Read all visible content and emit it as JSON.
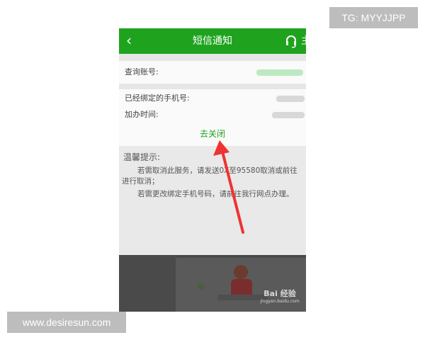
{
  "topbar": {
    "back_icon": "chevron-left-icon",
    "title": "短信通知",
    "headset_icon": "headset-icon",
    "extra_label": "主",
    "color": "#1fa31f"
  },
  "account": {
    "label": "查询账号:"
  },
  "binding": {
    "phone_label": "已经绑定的手机号:",
    "time_label": "加办时间:"
  },
  "close_link": "去关闭",
  "tips": {
    "title": "温馨提示:",
    "line1": "若需取消此服务，请发送0X至95580取消或前往",
    "line2": "进行取消；",
    "line3": "若需更改绑定手机号码，请前往我行网点办理。"
  },
  "watermark": {
    "baidu_main": "Bai 经验",
    "baidu_sub": "jingyan.baidu.com",
    "top_right": "TG: MYYJJPP",
    "bottom_left": "www.desiresun.com"
  }
}
